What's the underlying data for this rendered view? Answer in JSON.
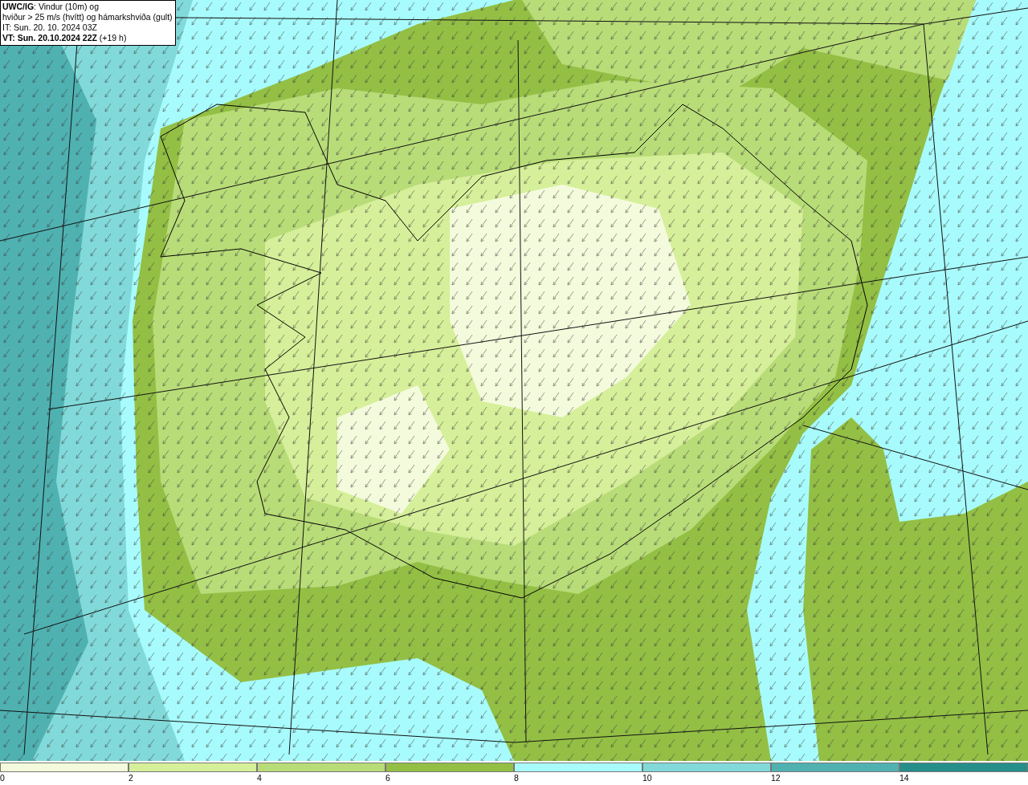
{
  "info_box": {
    "lines": [
      "**UWC/IG**: Vindur (10m) og",
      "hviður > 25 m/s (hvítt) og hámarkshviða (gult)",
      "IT: Sun. 20. 10. 2024 03Z",
      "**VT: Sun. 20.10.2024 22Z** (+19 h)"
    ]
  },
  "color_scale": {
    "segments": [
      {
        "color": "#f4fbdc"
      },
      {
        "color": "#d6ef9a"
      },
      {
        "color": "#b8dc78"
      },
      {
        "color": "#93bf45"
      },
      {
        "color": "#a8fbfc"
      },
      {
        "color": "#82d9d9"
      },
      {
        "color": "#50b1b1"
      },
      {
        "color": "#268f8a"
      }
    ],
    "ticks": [
      "0",
      "2",
      "4",
      "6",
      "8",
      "10",
      "12",
      "14"
    ]
  }
}
